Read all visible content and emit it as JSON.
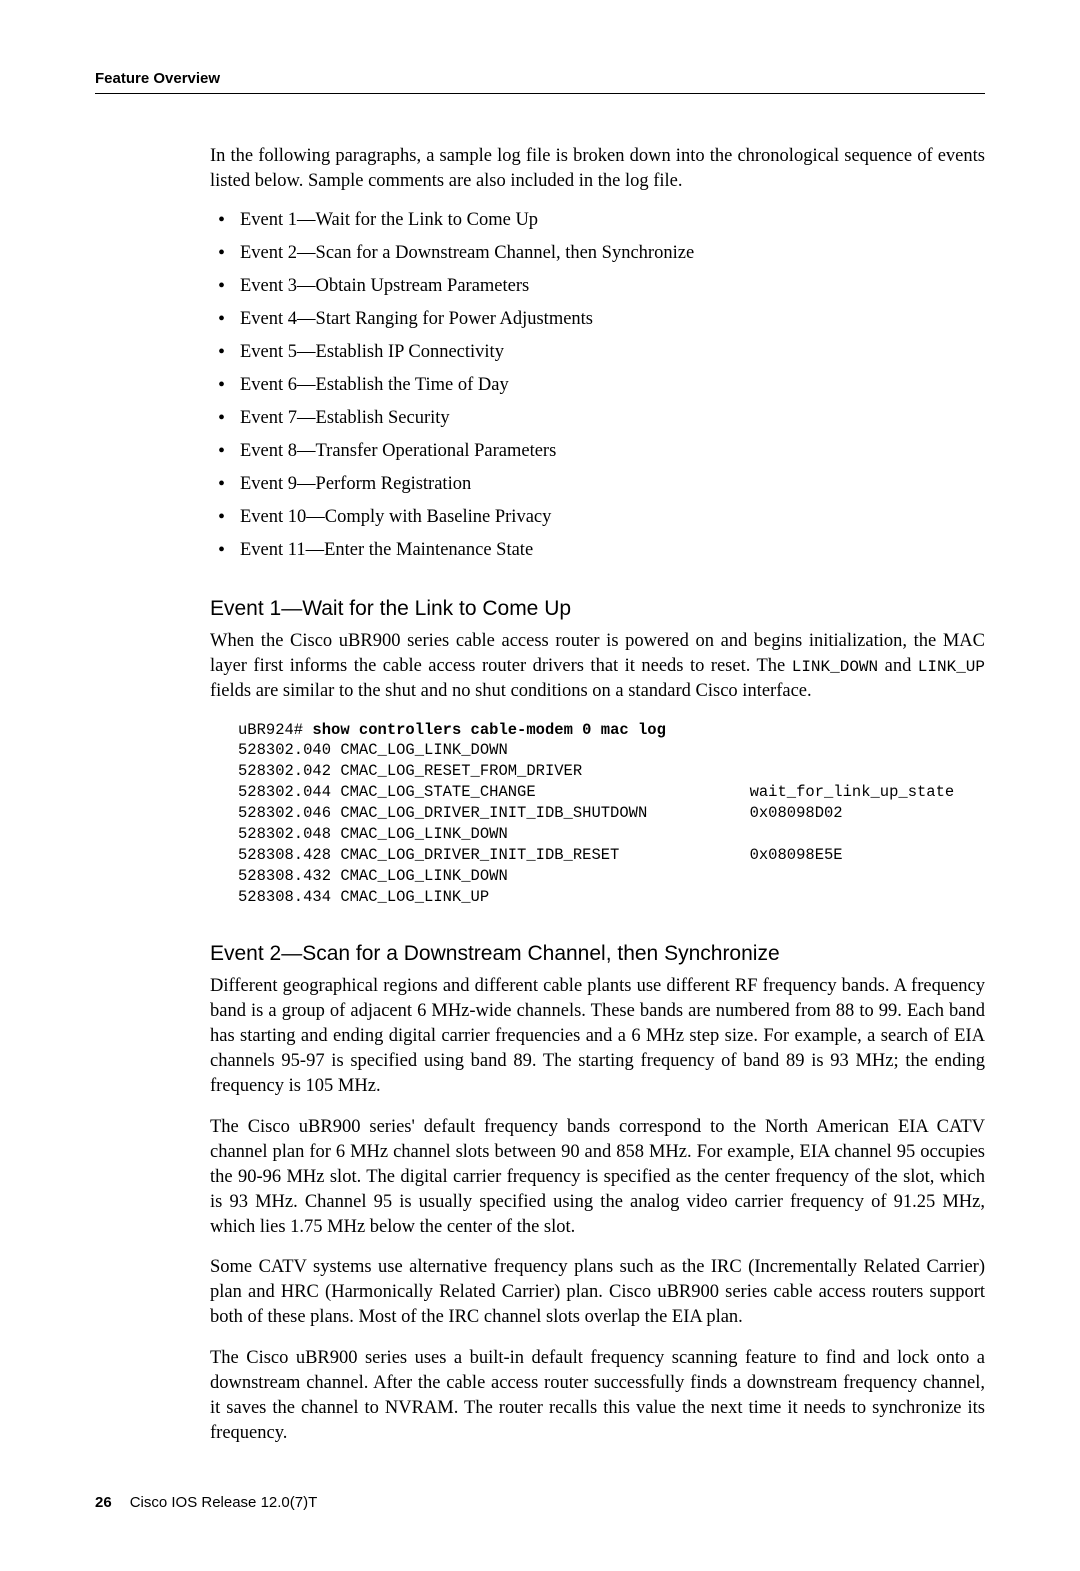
{
  "header": {
    "section": "Feature Overview"
  },
  "intro": "In the following paragraphs, a sample log file is broken down into the chronological sequence of events listed below. Sample comments are also included in the log file.",
  "events_list": [
    "Event 1—Wait for the Link to Come Up",
    "Event 2—Scan for a Downstream Channel, then Synchronize",
    "Event 3—Obtain Upstream Parameters",
    "Event 4—Start Ranging for Power Adjustments",
    "Event 5—Establish IP Connectivity",
    "Event 6—Establish the Time of Day",
    "Event 7—Establish Security",
    "Event 8—Transfer Operational Parameters",
    "Event 9—Perform Registration",
    "Event 10—Comply with Baseline Privacy",
    "Event 11—Enter the Maintenance State"
  ],
  "event1": {
    "heading": "Event 1—Wait for the Link to Come Up",
    "para_pre": "When the Cisco uBR900 series cable access router is powered on and begins initialization, the MAC layer first informs the cable access router drivers that it needs to reset. The ",
    "code1": "LINK_DOWN",
    "para_mid": " and ",
    "code2": "LINK_UP",
    "para_post": " fields are similar to the shut and no shut conditions on a standard Cisco interface.",
    "code_prompt": "uBR924# ",
    "code_cmd": "show controllers cable-modem 0 mac log",
    "code_lines": [
      "528302.040 CMAC_LOG_LINK_DOWN",
      "528302.042 CMAC_LOG_RESET_FROM_DRIVER",
      "528302.044 CMAC_LOG_STATE_CHANGE                       wait_for_link_up_state",
      "528302.046 CMAC_LOG_DRIVER_INIT_IDB_SHUTDOWN           0x08098D02",
      "528302.048 CMAC_LOG_LINK_DOWN",
      "528308.428 CMAC_LOG_DRIVER_INIT_IDB_RESET              0x08098E5E",
      "528308.432 CMAC_LOG_LINK_DOWN",
      "528308.434 CMAC_LOG_LINK_UP"
    ]
  },
  "event2": {
    "heading": "Event  2—Scan for a Downstream Channel, then Synchronize",
    "p1": "Different geographical regions and different cable plants use different RF frequency bands. A frequency band is a group of adjacent 6 MHz-wide channels. These bands are numbered from 88 to 99. Each band has starting and ending digital carrier frequencies and a 6 MHz step size. For example, a search of EIA channels 95-97 is specified using band 89. The starting frequency of band 89 is 93 MHz; the ending frequency is 105 MHz.",
    "p2": "The Cisco uBR900 series' default frequency bands correspond to the North American EIA CATV channel plan for 6 MHz channel slots between 90 and 858 MHz. For example, EIA channel 95 occupies the 90-96 MHz slot. The digital carrier frequency is specified as the center frequency of the slot, which is 93 MHz. Channel 95 is usually specified using the analog video carrier frequency of 91.25 MHz, which lies 1.75 MHz below the center of the slot.",
    "p3": "Some CATV systems use alternative frequency plans such as the IRC (Incrementally Related Carrier) plan and HRC (Harmonically Related Carrier) plan. Cisco uBR900 series cable access routers support both of these plans. Most of the IRC channel slots overlap the EIA plan.",
    "p4": "The Cisco uBR900 series uses a built-in default frequency scanning feature to find and lock onto a downstream channel. After the cable access router successfully finds a downstream frequency channel, it saves the channel to NVRAM. The router recalls this value the next time it needs to synchronize its frequency."
  },
  "footer": {
    "page_number": "26",
    "release": "Cisco IOS Release 12.0(7)T"
  }
}
